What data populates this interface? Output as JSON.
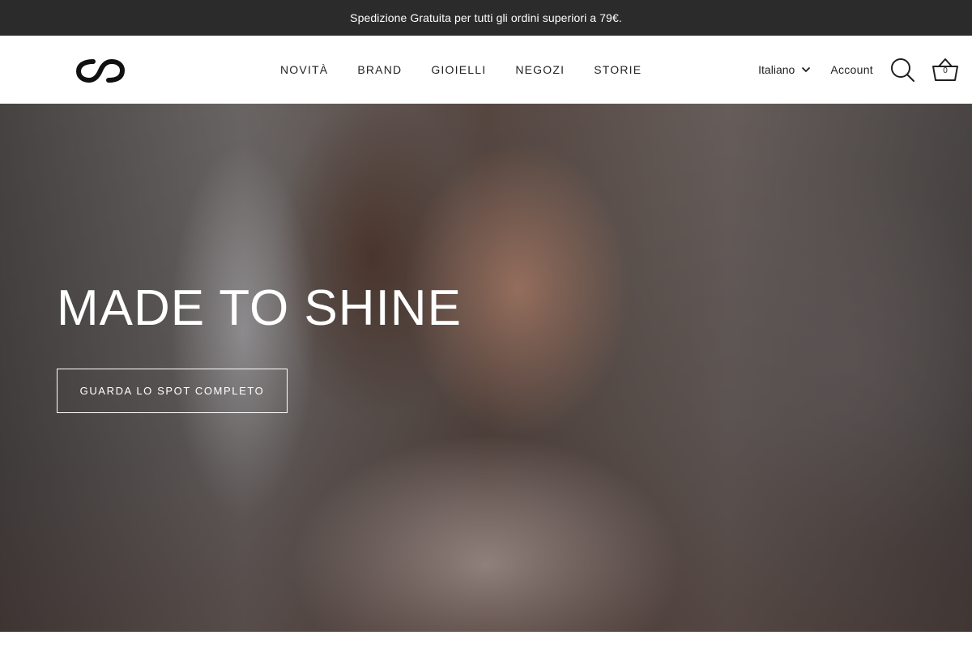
{
  "announcement": {
    "text": "Spedizione Gratuita per tutti gli ordini superiori a 79€."
  },
  "header": {
    "nav": [
      {
        "label": "NOVITÀ"
      },
      {
        "label": "BRAND"
      },
      {
        "label": "GIOIELLI"
      },
      {
        "label": "NEGOZI"
      },
      {
        "label": "STORIE"
      }
    ],
    "language": "Italiano",
    "account_label": "Account",
    "cart_count": "0",
    "icons": {
      "logo": "infinity-logo-icon",
      "search": "search-icon",
      "cart": "basket-icon",
      "language": "chevron-down-icon"
    }
  },
  "hero": {
    "title": "MADE TO SHINE",
    "cta_label": "GUARDA LO SPOT COMPLETO"
  },
  "colors": {
    "announcement_bg": "#2b2b2b",
    "header_bg": "#ffffff",
    "text_dark": "#1f1f1f",
    "hero_text": "#ffffff"
  }
}
